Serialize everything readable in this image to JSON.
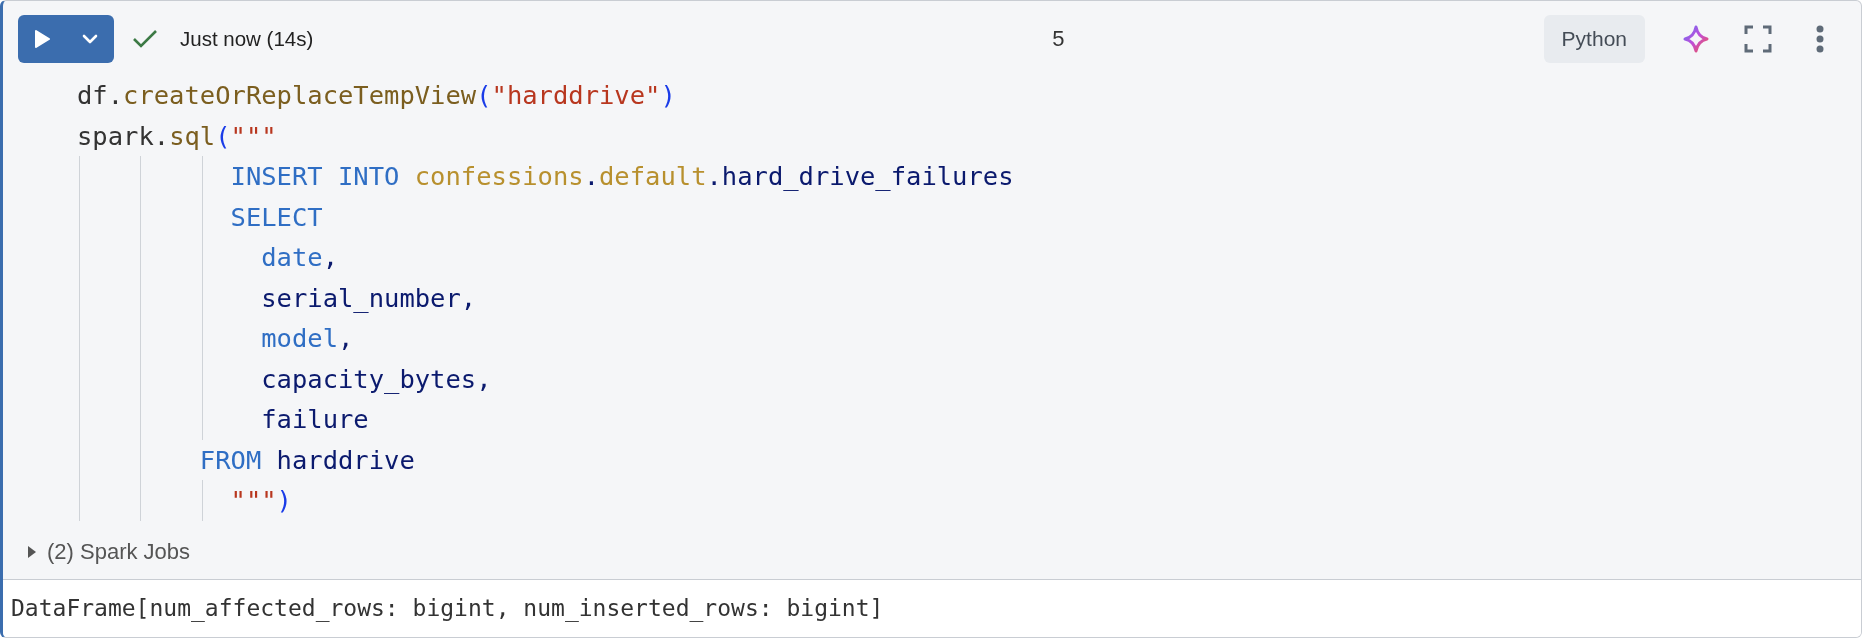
{
  "toolbar": {
    "status": {
      "succeeded": true,
      "text": "Just now (14s)"
    },
    "cell_number": "5",
    "language": "Python"
  },
  "code": [
    {
      "tokens": [
        {
          "kind": "plain",
          "text": "df."
        },
        {
          "kind": "func",
          "text": "createOrReplaceTempView"
        },
        {
          "kind": "paren",
          "text": "("
        },
        {
          "kind": "string",
          "text": "\"harddrive\""
        },
        {
          "kind": "paren",
          "text": ")"
        }
      ]
    },
    {
      "tokens": [
        {
          "kind": "plain",
          "text": "spark."
        },
        {
          "kind": "func",
          "text": "sql"
        },
        {
          "kind": "paren",
          "text": "("
        },
        {
          "kind": "string",
          "text": "\"\"\""
        }
      ]
    },
    {
      "tokens": [
        {
          "kind": "keyword",
          "text": "          INSERT INTO "
        },
        {
          "kind": "table",
          "text": "confessions"
        },
        {
          "kind": "ident",
          "text": "."
        },
        {
          "kind": "table",
          "text": "default"
        },
        {
          "kind": "ident",
          "text": ".hard_drive_failures"
        }
      ]
    },
    {
      "tokens": [
        {
          "kind": "keyword",
          "text": "          SELECT"
        }
      ]
    },
    {
      "tokens": [
        {
          "kind": "keyword",
          "text": "            date"
        },
        {
          "kind": "ident",
          "text": ","
        }
      ]
    },
    {
      "tokens": [
        {
          "kind": "ident",
          "text": "            serial_number,"
        }
      ]
    },
    {
      "tokens": [
        {
          "kind": "keyword",
          "text": "            model"
        },
        {
          "kind": "ident",
          "text": ","
        }
      ]
    },
    {
      "tokens": [
        {
          "kind": "ident",
          "text": "            capacity_bytes,"
        }
      ]
    },
    {
      "tokens": [
        {
          "kind": "ident",
          "text": "            failure"
        }
      ]
    },
    {
      "tokens": [
        {
          "kind": "keyword",
          "text": "        FROM "
        },
        {
          "kind": "ident",
          "text": "harddrive"
        }
      ]
    },
    {
      "tokens": [
        {
          "kind": "string",
          "text": "          \"\"\""
        },
        {
          "kind": "paren",
          "text": ")"
        }
      ]
    }
  ],
  "spark_jobs": {
    "label": "(2) Spark Jobs",
    "expanded": false
  },
  "output": "DataFrame[num_affected_rows: bigint, num_inserted_rows: bigint]"
}
